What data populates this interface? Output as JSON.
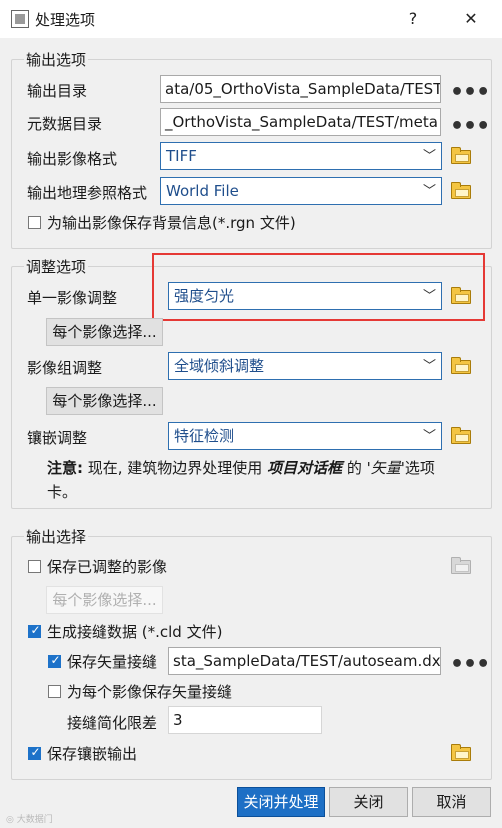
{
  "window": {
    "title": "处理选项",
    "help_glyph": "?",
    "close_glyph": "✕"
  },
  "output_options": {
    "group_label": "输出选项",
    "output_dir_label": "输出目录",
    "output_dir_value": "ata/05_OrthoVista_SampleData/TEST",
    "metadata_dir_label": "元数据目录",
    "metadata_dir_value": "_OrthoVista_SampleData/TEST/meta",
    "image_format_label": "输出影像格式",
    "image_format_value": "TIFF",
    "georef_format_label": "输出地理参照格式",
    "georef_format_value": "World File",
    "save_bg_label": "为输出影像保存背景信息(*.rgn 文件)",
    "save_bg_checked": false
  },
  "adjust_options": {
    "group_label": "调整选项",
    "single_label": "单一影像调整",
    "single_value": "强度匀光",
    "per_image_btn1": "每个影像选择...",
    "group_adjust_label": "影像组调整",
    "group_adjust_value": "全域倾斜调整",
    "per_image_btn2": "每个影像选择...",
    "mosaic_label": "镶嵌调整",
    "mosaic_value": "特征检测",
    "note_prefix": "注意:",
    "note_mid": " 现在, 建筑物边界处理使用 ",
    "note_em": "项目对话框",
    "note_de": " 的 '",
    "note_vector": "矢量",
    "note_suffix": "'选项",
    "note_line2": "卡。"
  },
  "output_select": {
    "group_label": "输出选择",
    "save_adjusted_label": "保存已调整的影像",
    "save_adjusted_checked": false,
    "per_image_btn3": "每个影像选择...",
    "gen_seam_label": "生成接缝数据 (*.cld 文件)",
    "gen_seam_checked": true,
    "save_vector_label": "保存矢量接缝",
    "save_vector_checked": true,
    "save_vector_value": "sta_SampleData/TEST/autoseam.dxf",
    "per_image_vector_label": "为每个影像保存矢量接缝",
    "per_image_vector_checked": false,
    "simplify_label": "接缝简化限差",
    "simplify_value": "3",
    "save_mosaic_label": "保存镶嵌输出",
    "save_mosaic_checked": true
  },
  "footer": {
    "close_process": "关闭并处理",
    "close": "关闭",
    "cancel": "取消"
  },
  "colors": {
    "primary_button": "#1d6fc5",
    "highlight_box": "#e53935",
    "combo_text": "#1f4e8c"
  }
}
